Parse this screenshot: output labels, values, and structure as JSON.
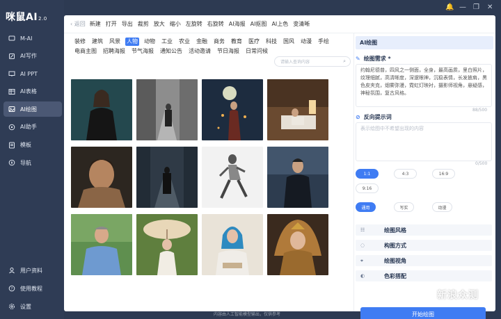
{
  "app": {
    "logo_text": "咪鼠AI",
    "logo_version": "2.0"
  },
  "sidebar": {
    "items": [
      {
        "label": "M-AI",
        "icon": "chat-icon"
      },
      {
        "label": "AI写作",
        "icon": "pen-icon"
      },
      {
        "label": "AI PPT",
        "icon": "slides-icon"
      },
      {
        "label": "AI表格",
        "icon": "table-icon"
      },
      {
        "label": "AI绘图",
        "icon": "image-icon",
        "active": true
      },
      {
        "label": "AI助手",
        "icon": "assistant-icon"
      },
      {
        "label": "模板",
        "icon": "template-icon"
      },
      {
        "label": "导航",
        "icon": "compass-icon"
      }
    ],
    "bottom": [
      {
        "label": "用户资料",
        "icon": "user-icon"
      },
      {
        "label": "使用教程",
        "icon": "help-icon"
      },
      {
        "label": "设置",
        "icon": "gear-icon"
      }
    ]
  },
  "toolbar": {
    "back": "返回",
    "items": [
      "新建",
      "打开",
      "导出",
      "裁剪",
      "放大",
      "缩小",
      "左旋转",
      "右旋转",
      "AI海报",
      "AI抠图",
      "AI上色",
      "变清晰"
    ]
  },
  "categories": {
    "row1": [
      "装修",
      "建筑",
      "风景",
      "人物",
      "动物",
      "工业",
      "农业",
      "金融",
      "商务",
      "教育",
      "医疗",
      "科技",
      "国风",
      "动漫",
      "手绘"
    ],
    "row2": [
      "电商主图",
      "招聘海报",
      "节气海报",
      "通知公告",
      "活动邀请",
      "节日海报",
      "日常问候"
    ],
    "active": "人物"
  },
  "search": {
    "placeholder": "请输入查询内容"
  },
  "footer_note": "内容由人工智能模型输出，仅供参考",
  "panel": {
    "title": "AI绘图",
    "prompt_label": "绘图需求 *",
    "prompt_text": "约翰尼德普，四风之一侧面，全身，最高画质，里白照片，纹理细腻，高清晰度，深邃眼神，沉稳表情，长发披肩，黑色皮夹克，烟雾弥漫，霓虹灯映衬，摄影师视角，悬疑感，神秘氛围，复古风格。",
    "prompt_count": "88/500",
    "negative_label": "反向提示词",
    "negative_placeholder": "表示绘图中不希望出现的内容",
    "negative_count": "0/500",
    "ratios": [
      "1:1",
      "4:3",
      "16:9",
      "9:16"
    ],
    "active_ratio": "1:1",
    "styles": [
      "通用",
      "写实",
      "动漫"
    ],
    "active_style": "通用",
    "options": [
      {
        "label": "绘图风格",
        "icon": "grid-icon"
      },
      {
        "label": "构图方式",
        "icon": "layout-icon"
      },
      {
        "label": "绘图视角",
        "icon": "camera-icon"
      },
      {
        "label": "色彩搭配",
        "icon": "palette-icon"
      }
    ],
    "generate_label": "开始绘图"
  },
  "site_watermark": "新浪众测",
  "colors": {
    "accent": "#3f7cf3",
    "sidebar_bg": "#2f3c55",
    "panel_head_bg": "#e7eefc"
  }
}
